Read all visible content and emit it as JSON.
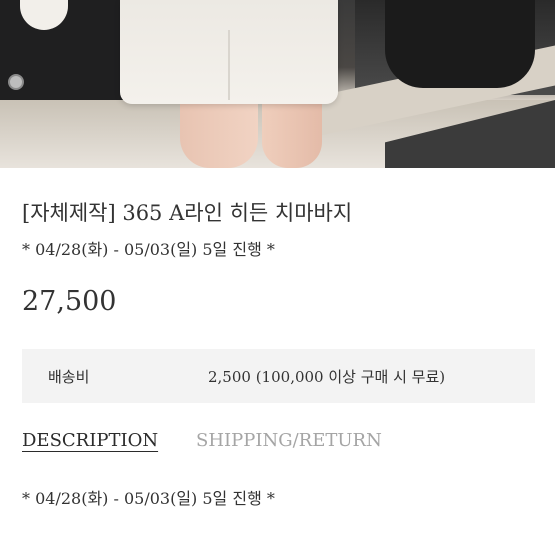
{
  "product": {
    "title": "[자체제작] 365 A라인 히든 치마바지",
    "schedule_note": "* 04/28(화) - 05/03(일) 5일 진행 *",
    "price": "27,500"
  },
  "shipping": {
    "label": "배송비",
    "value": "2,500 (100,000 이상 구매 시 무료)"
  },
  "tabs": [
    {
      "label": "DESCRIPTION",
      "active": true
    },
    {
      "label": "SHIPPING/RETURN",
      "active": false
    }
  ],
  "description": {
    "schedule_note": "* 04/28(화) - 05/03(일) 5일 진행 *"
  },
  "colors": {
    "text": "#2b2b2b",
    "inactive_tab": "#a5a5a5",
    "shipping_bg": "#f3f3f3"
  }
}
